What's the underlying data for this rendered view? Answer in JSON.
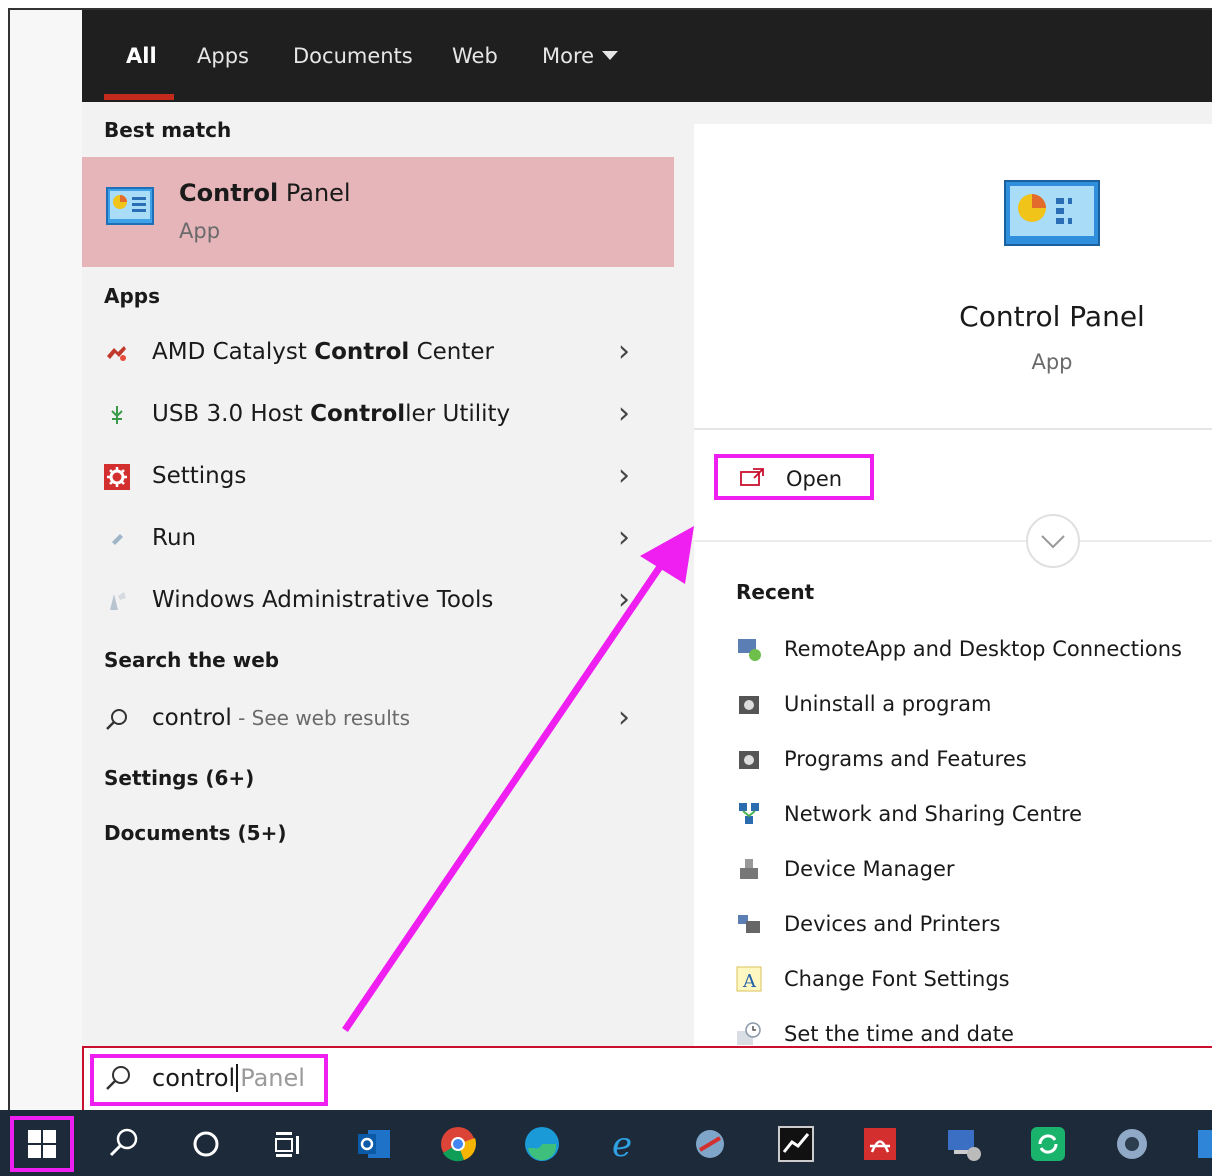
{
  "tabs": [
    {
      "label": "All",
      "active": true
    },
    {
      "label": "Apps"
    },
    {
      "label": "Documents"
    },
    {
      "label": "Web"
    },
    {
      "label": "More"
    }
  ],
  "left": {
    "best_match_header": "Best match",
    "best_match": {
      "title_bold": "Control",
      "title_rest": " Panel",
      "subtitle": "App",
      "icon": "control-panel-icon"
    },
    "apps_header": "Apps",
    "apps": [
      {
        "pre": "AMD Catalyst ",
        "bold": "Control",
        "post": " Center",
        "icon": "amd-catalyst-icon"
      },
      {
        "pre": "USB 3.0 Host ",
        "bold": "Control",
        "post": "ler Utility",
        "icon": "usb-icon"
      },
      {
        "pre": "Settings",
        "bold": "",
        "post": "",
        "icon": "settings-gear-icon"
      },
      {
        "pre": "Run",
        "bold": "",
        "post": "",
        "icon": "run-icon"
      },
      {
        "pre": "Windows Administrative Tools",
        "bold": "",
        "post": "",
        "icon": "admin-tools-icon"
      }
    ],
    "web_header": "Search the web",
    "web_result": {
      "query": "control",
      "hint": " - See web results"
    },
    "settings_header": "Settings (6+)",
    "documents_header": "Documents (5+)"
  },
  "preview": {
    "title": "Control Panel",
    "subtitle": "App",
    "open_label": "Open",
    "recent_header": "Recent",
    "recent": [
      {
        "label": "RemoteApp and Desktop Connections",
        "icon": "remoteapp-icon"
      },
      {
        "label": "Uninstall a program",
        "icon": "programs-icon"
      },
      {
        "label": "Programs and Features",
        "icon": "programs-icon"
      },
      {
        "label": "Network and Sharing Centre",
        "icon": "network-icon"
      },
      {
        "label": "Device Manager",
        "icon": "device-manager-icon"
      },
      {
        "label": "Devices and Printers",
        "icon": "printer-icon"
      },
      {
        "label": "Change Font Settings",
        "icon": "font-icon"
      },
      {
        "label": "Set the time and date",
        "icon": "clock-icon"
      }
    ]
  },
  "search": {
    "typed": "control",
    "completion": "Panel"
  },
  "taskbar": {
    "icons": [
      "search-icon",
      "cortana-icon",
      "task-view-icon",
      "outlook-icon",
      "chrome-icon",
      "edge-icon",
      "internet-explorer-icon",
      "app-icon",
      "stock-app-icon",
      "acrobat-icon",
      "network-app-icon",
      "refresh-app-icon",
      "support-app-icon"
    ]
  },
  "colors": {
    "highlight_magenta": "#ee1ff0",
    "best_match_bg": "#e5b5b9",
    "tab_accent": "#c42b1c",
    "taskbar_bg": "#1d2a3a"
  }
}
